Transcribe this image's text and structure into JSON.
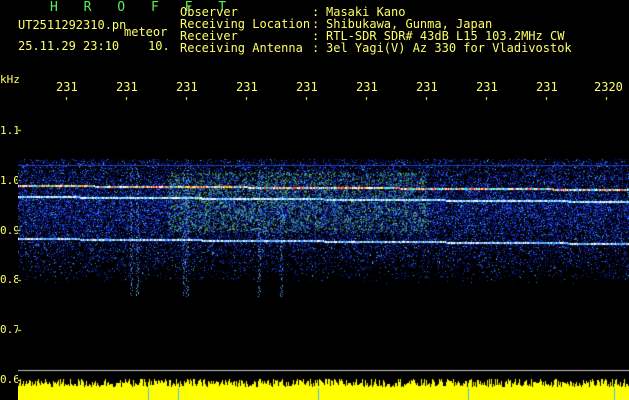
{
  "header": {
    "title": "H R O F F T",
    "filename": "UT2511292310.pn",
    "filename_suffix": "meteor",
    "datetime": "25.11.29 23:10",
    "interval": "10."
  },
  "info": [
    {
      "label": "Observer",
      "sep": ":",
      "value": "Masaki Kano"
    },
    {
      "label": "Receiving Location",
      "sep": ":",
      "value": "Shibukawa, Gunma, Japan"
    },
    {
      "label": "Receiver",
      "sep": ":",
      "value": "RTL-SDR SDR# 43dB L15 103.2MHz CW"
    },
    {
      "label": "Receiving Antenna",
      "sep": ":",
      "value": "3el Yagi(V) Az 330 for Vladivostok"
    }
  ],
  "axis": {
    "freq_unit": "kHz",
    "freq_ticks": [
      "1.1",
      "1.0",
      "0.9",
      "0.8",
      "0.7",
      "0.6"
    ],
    "time_ticks": [
      "231",
      "231",
      "231",
      "231",
      "231",
      "231",
      "231",
      "231",
      "231",
      "2320"
    ]
  },
  "colors": {
    "background": "#000000",
    "text": "#ffff66",
    "title": "#5af05a",
    "noise": "#1a2fd0",
    "signal": "#ffffff",
    "bottom_bar": "#ffff00"
  }
}
